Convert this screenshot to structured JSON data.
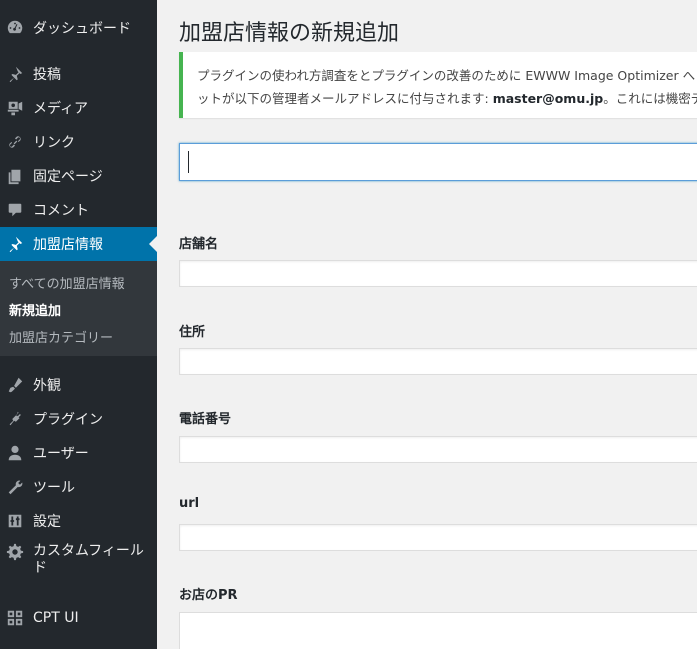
{
  "sidebar": {
    "items": [
      {
        "label": "ダッシュボード",
        "icon": "dashboard-icon"
      },
      {
        "label": "投稿",
        "icon": "pin-icon"
      },
      {
        "label": "メディア",
        "icon": "media-icon"
      },
      {
        "label": "リンク",
        "icon": "link-icon"
      },
      {
        "label": "固定ページ",
        "icon": "page-icon"
      },
      {
        "label": "コメント",
        "icon": "comment-icon"
      },
      {
        "label": "加盟店情報",
        "icon": "pin-icon"
      },
      {
        "label": "外観",
        "icon": "appearance-icon"
      },
      {
        "label": "プラグイン",
        "icon": "plugin-icon"
      },
      {
        "label": "ユーザー",
        "icon": "user-icon"
      },
      {
        "label": "ツール",
        "icon": "wrench-icon"
      },
      {
        "label": "設定",
        "icon": "settings-icon"
      },
      {
        "label": "カスタムフィールド",
        "icon": "gear-icon"
      },
      {
        "label": "CPT UI",
        "icon": "cpt-grid-icon"
      }
    ],
    "submenu": [
      {
        "label": "すべての加盟店情報"
      },
      {
        "label": "新規追加"
      },
      {
        "label": "加盟店カテゴリー"
      }
    ],
    "active_color": "#0073aa",
    "background_color": "#23282d"
  },
  "main": {
    "title": "加盟店情報の新規追加",
    "notice": {
      "line1": "プラグインの使われ方調査をとプラグインの改善のために EWWW Image Optimizer へ",
      "line2_prefix": "ットが以下の管理者メールアドレスに付与されます: ",
      "email": "master@omu.jp",
      "line2_suffix": "。これには機密デ",
      "accent_color": "#46b450"
    },
    "title_input": {
      "value": ""
    },
    "fields": [
      {
        "label": "店舗名",
        "value": ""
      },
      {
        "label": "住所",
        "value": ""
      },
      {
        "label": "電話番号",
        "value": ""
      },
      {
        "label": "url",
        "value": ""
      },
      {
        "label": "お店のPR",
        "value": ""
      }
    ]
  }
}
